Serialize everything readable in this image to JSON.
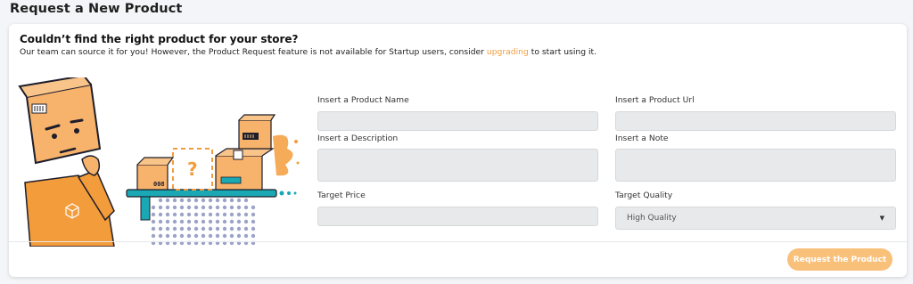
{
  "page": {
    "title": "Request a New Product"
  },
  "notice": {
    "headline": "Couldn’t find the right product for your store?",
    "text_before": "Our team can source it for you! However, the Product Request feature is not available for Startup users, consider ",
    "link_text": "upgrading",
    "text_after": " to start using it."
  },
  "illustration": {
    "box_label": "008",
    "question_mark": "?"
  },
  "form": {
    "product_name": {
      "label": "Insert a Product Name",
      "value": ""
    },
    "product_url": {
      "label": "Insert a Product Url",
      "value": ""
    },
    "description": {
      "label": "Insert a Description",
      "value": ""
    },
    "note": {
      "label": "Insert a Note",
      "value": ""
    },
    "target_price": {
      "label": "Target Price",
      "value": ""
    },
    "target_quality": {
      "label": "Target Quality",
      "selected": "High Quality",
      "caret": "▼"
    }
  },
  "actions": {
    "submit_label": "Request the Product"
  },
  "colors": {
    "accent": "#f39c3b",
    "button": "#f9c07a",
    "teal": "#19a8b4",
    "dot": "#9ba3c7"
  }
}
